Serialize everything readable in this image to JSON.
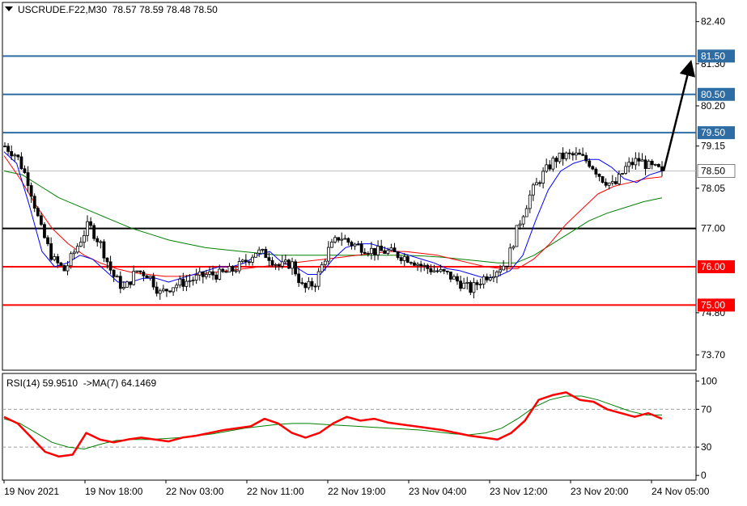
{
  "header": {
    "symbol": "USCRUDE.F22,M30",
    "ohlc": "78.57 78.59 78.48 78.50"
  },
  "rsi_header": {
    "label": "RSI(14) 59.9510",
    "ma_label": "->MA(7) 64.1469"
  },
  "colors": {
    "background": "#ffffff",
    "candle": "#000000",
    "ma_fast": "#0000ff",
    "ma_mid": "#ff0000",
    "ma_slow": "#008000",
    "resistance_line": "#2e6da4",
    "support_line": "#ff0000",
    "pivot_line": "#000000",
    "current_price_line": "#c0c0c0",
    "arrow": "#000000",
    "rsi_line": "#ff0000",
    "rsi_ma_line": "#008000"
  },
  "chart_data": {
    "type": "candlestick",
    "price_axis_ticks": [
      "82.40",
      "81.30",
      "80.20",
      "79.15",
      "78.05",
      "74.80",
      "73.70"
    ],
    "price_range": [
      73.3,
      82.9
    ],
    "time_axis_labels": [
      "19 Nov 2021",
      "19 Nov 18:00",
      "22 Nov 03:00",
      "22 Nov 11:00",
      "22 Nov 19:00",
      "23 Nov 04:00",
      "23 Nov 12:00",
      "23 Nov 20:00",
      "24 Nov 05:00"
    ],
    "current_price": "78.50",
    "levels": [
      {
        "value": 81.5,
        "label": "81.50",
        "kind": "resistance"
      },
      {
        "value": 80.5,
        "label": "80.50",
        "kind": "resistance"
      },
      {
        "value": 79.5,
        "label": "79.50",
        "kind": "resistance"
      },
      {
        "value": 77.0,
        "label": "77.00",
        "kind": "pivot"
      },
      {
        "value": 76.0,
        "label": "76.00",
        "kind": "support"
      },
      {
        "value": 75.0,
        "label": "75.00",
        "kind": "support"
      }
    ],
    "arrow": {
      "from": 78.5,
      "to": 81.3
    },
    "close_path": [
      79.15,
      78.9,
      78.2,
      77.0,
      76.2,
      75.9,
      76.5,
      77.1,
      76.6,
      75.8,
      75.4,
      75.9,
      75.8,
      75.3,
      75.5,
      75.6,
      75.7,
      75.8,
      75.8,
      75.9,
      76.1,
      76.4,
      76.3,
      76.0,
      76.1,
      75.4,
      75.6,
      76.4,
      76.8,
      76.6,
      76.5,
      76.4,
      76.4,
      76.3,
      76.2,
      76.0,
      75.9,
      75.8,
      75.6,
      75.4,
      75.7,
      75.9,
      76.1,
      77.1,
      77.9,
      78.4,
      78.8,
      78.9,
      78.9,
      78.7,
      78.3,
      78.1,
      78.6,
      78.8,
      78.6,
      78.5
    ],
    "ma_fast_path": [
      79.0,
      78.7,
      77.6,
      76.4,
      76.0,
      76.1,
      76.3,
      76.2,
      75.9,
      75.6,
      75.6,
      75.7,
      75.7,
      75.6,
      75.7,
      75.8,
      75.9,
      76.0,
      76.0,
      76.1,
      76.3,
      76.4,
      76.1,
      76.0,
      75.8,
      75.8,
      76.2,
      76.5,
      76.6,
      76.6,
      76.5,
      76.4,
      76.3,
      76.2,
      76.1,
      75.95,
      75.9,
      75.8,
      75.7,
      75.75,
      75.9,
      76.3,
      77.2,
      78.0,
      78.5,
      78.7,
      78.8,
      78.8,
      78.6,
      78.3,
      78.2,
      78.4,
      78.5
    ],
    "ma_mid_path": [
      78.9,
      78.3,
      77.6,
      77.0,
      76.6,
      76.3,
      76.1,
      75.95,
      75.85,
      75.8,
      75.75,
      75.75,
      75.8,
      75.85,
      75.9,
      75.95,
      76.0,
      76.05,
      76.1,
      76.15,
      76.2,
      76.25,
      76.3,
      76.35,
      76.4,
      76.4,
      76.35,
      76.3,
      76.2,
      76.1,
      76.0,
      75.95,
      75.95,
      76.2,
      76.6,
      77.1,
      77.5,
      77.9,
      78.1,
      78.2,
      78.3,
      78.35
    ],
    "ma_slow_path": [
      78.5,
      78.4,
      78.1,
      77.8,
      77.6,
      77.4,
      77.2,
      77.0,
      76.85,
      76.7,
      76.6,
      76.5,
      76.45,
      76.4,
      76.35,
      76.3,
      76.3,
      76.3,
      76.3,
      76.3,
      76.3,
      76.3,
      76.3,
      76.28,
      76.25,
      76.2,
      76.15,
      76.1,
      76.1,
      76.3,
      76.6,
      76.9,
      77.2,
      77.4,
      77.55,
      77.7,
      77.8
    ],
    "rsi": {
      "ticks": [
        "100",
        "70",
        "30",
        "0"
      ],
      "levels": [
        70,
        30
      ],
      "range": [
        -5,
        108
      ],
      "rsi_path": [
        62,
        55,
        40,
        25,
        20,
        22,
        45,
        38,
        35,
        38,
        40,
        38,
        36,
        40,
        42,
        45,
        48,
        50,
        52,
        60,
        55,
        45,
        40,
        45,
        55,
        62,
        58,
        60,
        56,
        54,
        52,
        50,
        48,
        45,
        42,
        40,
        38,
        45,
        58,
        80,
        85,
        88,
        80,
        78,
        70,
        66,
        62,
        66,
        60
      ],
      "ma_path": [
        60,
        55,
        45,
        35,
        30,
        28,
        33,
        37,
        38,
        38,
        39,
        40,
        42,
        44,
        47,
        50,
        52,
        54,
        55,
        55,
        54,
        53,
        52,
        51,
        50,
        49,
        48,
        46,
        44,
        43,
        45,
        50,
        60,
        72,
        80,
        84,
        84,
        80,
        74,
        68,
        64,
        64
      ]
    }
  }
}
